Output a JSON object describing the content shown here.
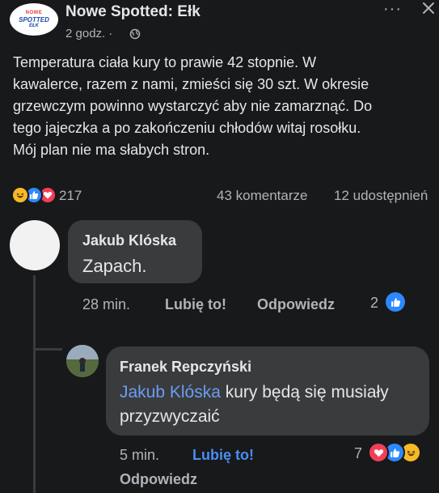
{
  "post": {
    "page_name": "Nowe Spotted: Ełk",
    "time": "2 godz. ·",
    "logo": {
      "line1": "NOWE",
      "line2": "SPOTTED",
      "line3": "EŁK"
    },
    "text": "Temperatura ciała kury to prawie 42 stopnie. W\nkawalerce, razem z nami, zmieści się 30 szt. W okresie\ngrzewczym powinno wystarczyć aby nie zamarznąć. Do\ntego jajeczka a po zakończeniu chłodów witaj rosołku.\nMój plan nie ma słabych stron.",
    "reactions_count": "217",
    "comments_count": "43 komentarze",
    "shares_count": "12 udostępnień",
    "more_icon": "···"
  },
  "comments": [
    {
      "author": "Jakub Klóska",
      "text": "Zapach.",
      "time": "28 min.",
      "like_label": "Lubię to!",
      "reply_label": "Odpowiedz",
      "reaction_count": "2"
    },
    {
      "author": "Franek Repczyński",
      "mention": "Jakub Klóska",
      "text": " kury będą się musiały przyzwyczaić",
      "time": "5 min.",
      "like_label": "Lubię to!",
      "reply_label": "Odpowiedz",
      "reaction_count": "7"
    }
  ],
  "colors": {
    "background": "#18191a",
    "bubble": "#3a3b3c",
    "text": "#e4e6eb",
    "secondary": "#b0b3b8",
    "link": "#4a8cf4",
    "like_blue": "#2d88ff",
    "love_red": "#f33e58",
    "haha_yellow": "#f7b928"
  },
  "icons": [
    "globe-icon",
    "more-icon",
    "close-icon",
    "haha-reaction-icon",
    "like-reaction-icon",
    "love-reaction-icon"
  ]
}
